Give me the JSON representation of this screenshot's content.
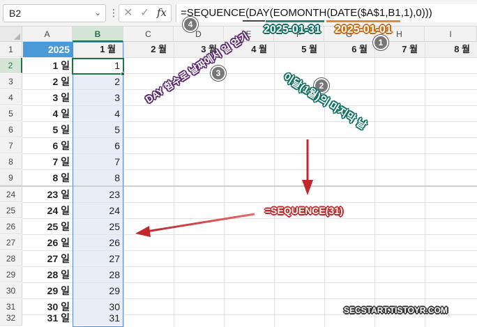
{
  "formula_bar": {
    "name_box": "B2",
    "formula": "=SEQUENCE(DAY(EOMONTH(DATE($A$1,B1,1),0)))"
  },
  "columns": [
    "A",
    "B",
    "C",
    "D",
    "E",
    "F",
    "G",
    "H",
    "I"
  ],
  "header_row": {
    "a1": "2025",
    "months": [
      "1 월",
      "2 월",
      "3 월",
      "4 월",
      "5 월",
      "6 월",
      "7 월",
      "8 월"
    ]
  },
  "rows_top": [
    {
      "row": "2",
      "day": "1 일",
      "value": "1"
    },
    {
      "row": "3",
      "day": "2 일",
      "value": "2"
    },
    {
      "row": "4",
      "day": "3 일",
      "value": "3"
    },
    {
      "row": "5",
      "day": "4 일",
      "value": "4"
    },
    {
      "row": "6",
      "day": "5 일",
      "value": "5"
    },
    {
      "row": "7",
      "day": "6 일",
      "value": "6"
    },
    {
      "row": "8",
      "day": "7 일",
      "value": "7"
    },
    {
      "row": "9",
      "day": "8 일",
      "value": "8"
    }
  ],
  "rows_bottom": [
    {
      "row": "24",
      "day": "23 일",
      "value": "23"
    },
    {
      "row": "25",
      "day": "24 일",
      "value": "24"
    },
    {
      "row": "26",
      "day": "25 일",
      "value": "25"
    },
    {
      "row": "27",
      "day": "26 일",
      "value": "26"
    },
    {
      "row": "28",
      "day": "27 일",
      "value": "27"
    },
    {
      "row": "29",
      "day": "28 일",
      "value": "28"
    },
    {
      "row": "30",
      "day": "29 일",
      "value": "29"
    },
    {
      "row": "31",
      "day": "30 일",
      "value": "30"
    },
    {
      "row": "32",
      "day": "31 일",
      "value": "31"
    }
  ],
  "annotations": {
    "step1": "1",
    "step2": "2",
    "step3": "3",
    "step4": "4",
    "eomonth_result": "2025-01-31",
    "date_result": "2025-01-01",
    "last_day_label": "이달(1월)의 마지막 날",
    "day_label": "DAY 함수로 날짜에서 일 얻기",
    "sequence_label": "=SEQUENCE(31)",
    "watermark": "SECSTART.TISTOYR.COM"
  },
  "colors": {
    "accent_green": "#217346",
    "header_blue": "#4a9ad8",
    "teal": "#1f8a7a",
    "orange": "#e48a2c",
    "purple": "#5a2a6e",
    "red": "#c0282c"
  }
}
